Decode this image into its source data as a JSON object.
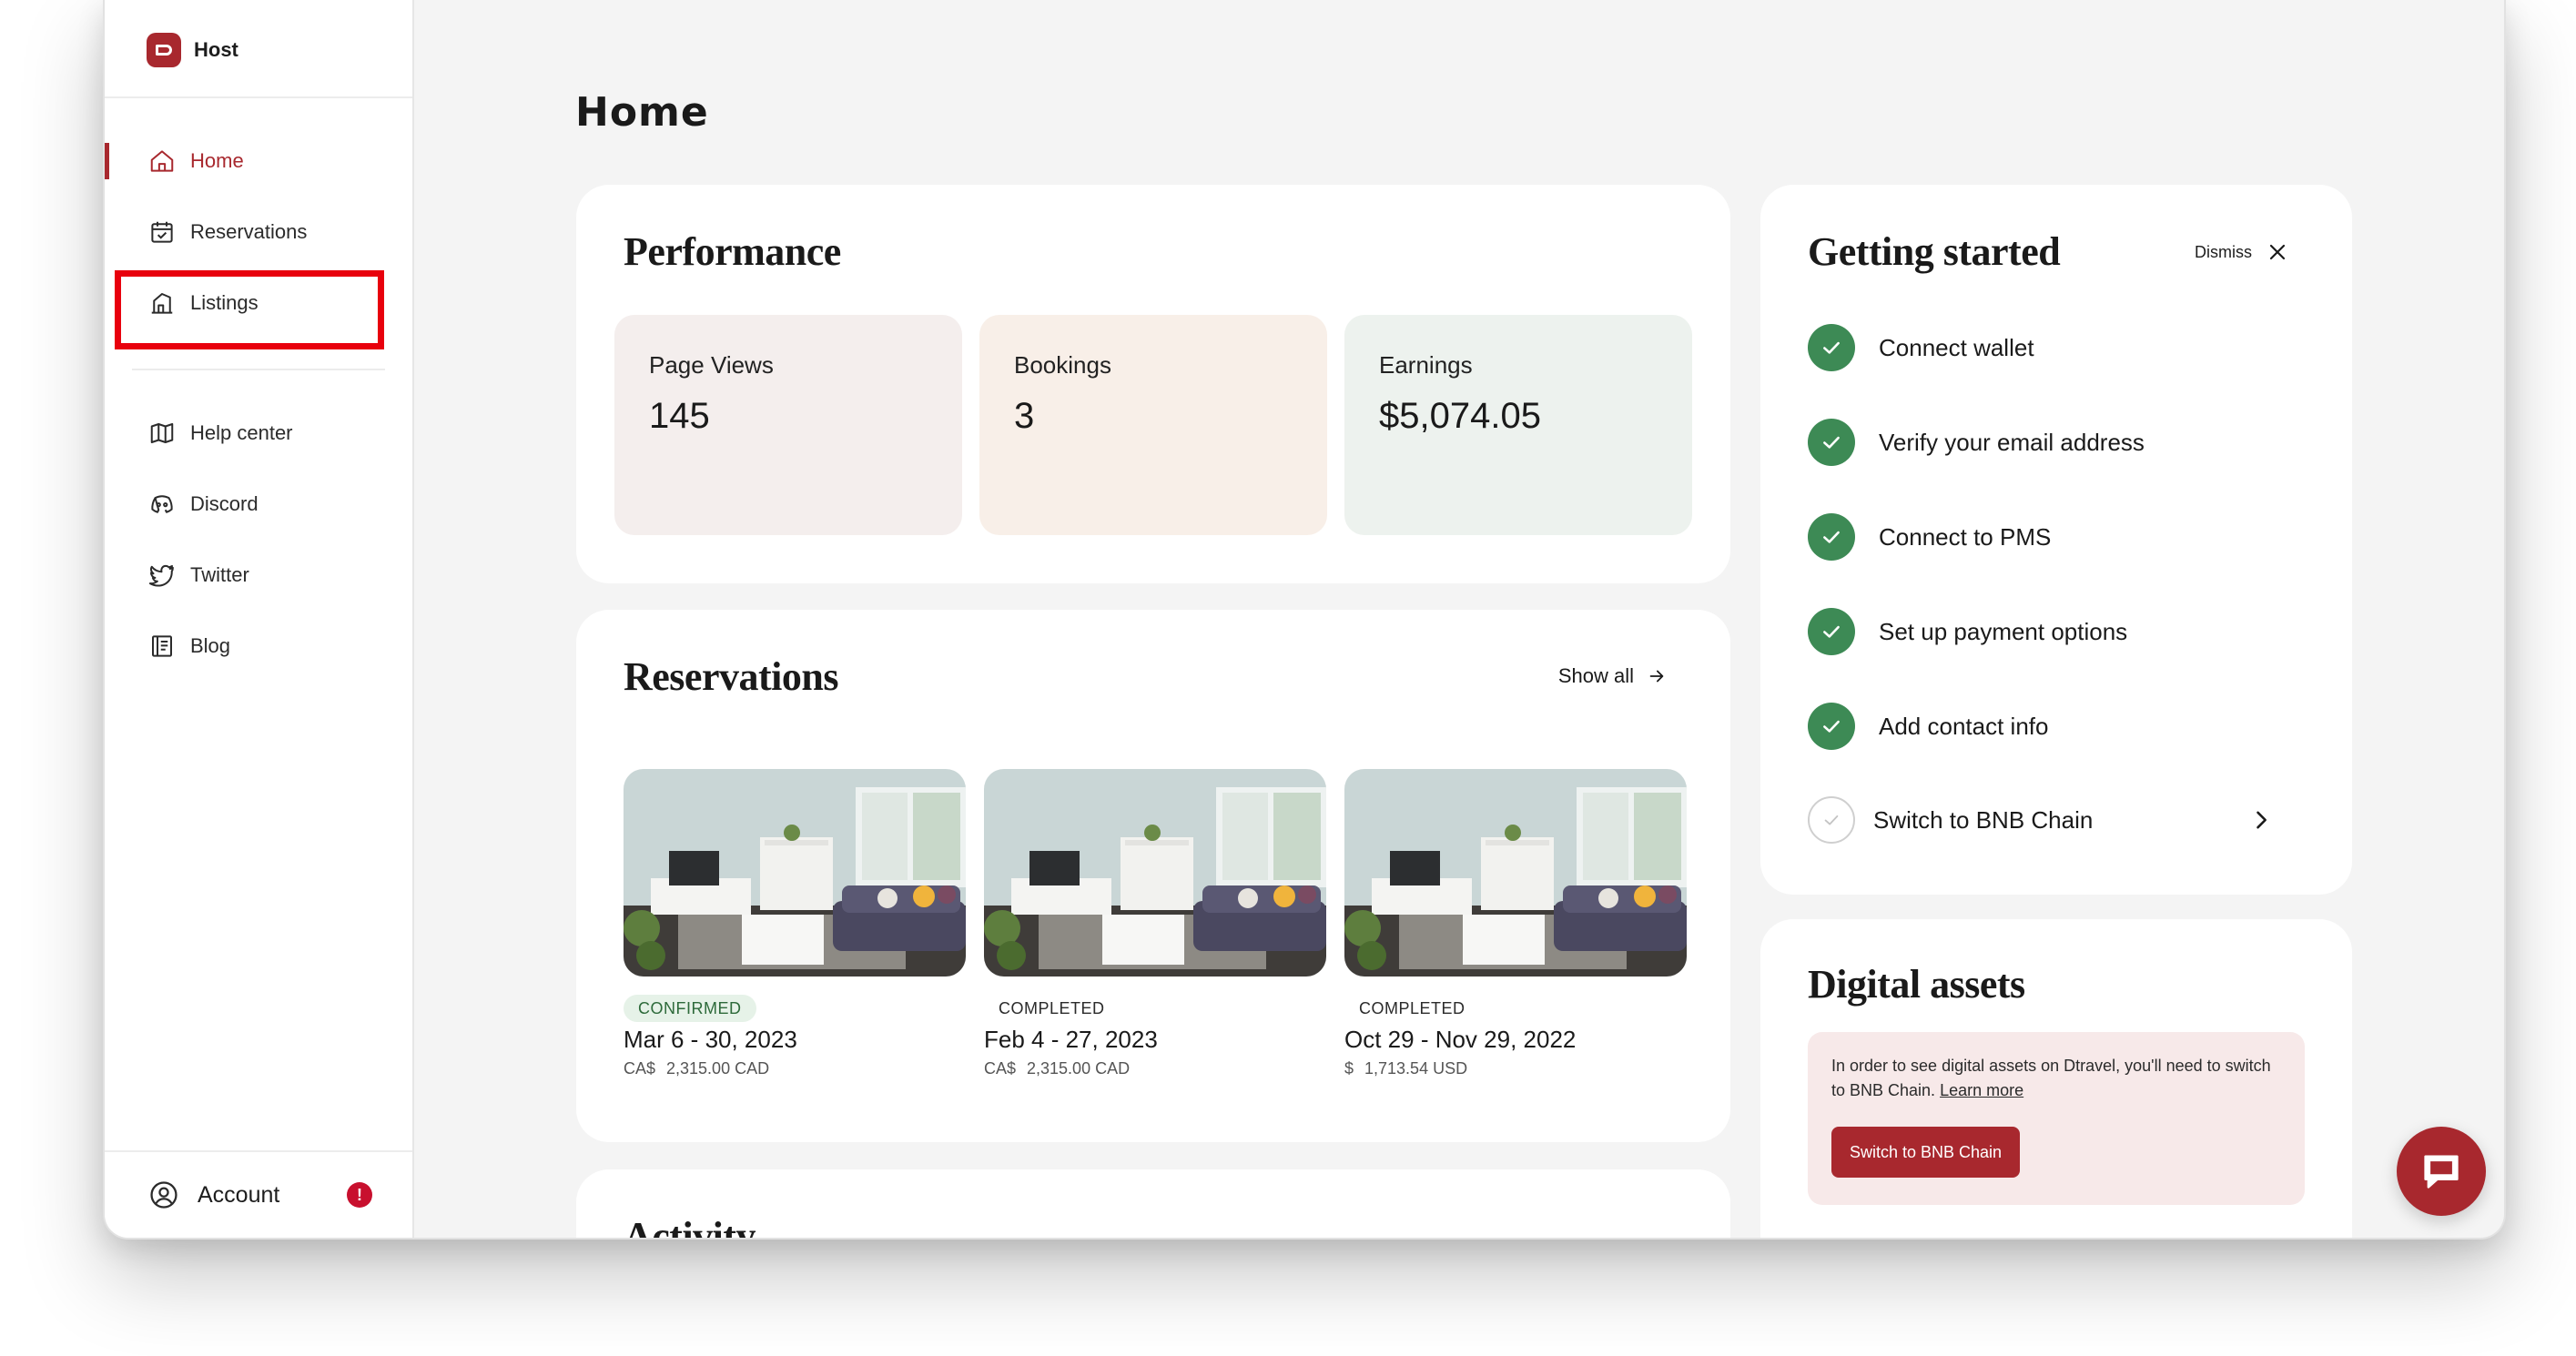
{
  "brand": {
    "name": "Host"
  },
  "sidebar": {
    "items": [
      {
        "label": "Home"
      },
      {
        "label": "Reservations"
      },
      {
        "label": "Listings"
      },
      {
        "label": "Help center"
      },
      {
        "label": "Discord"
      },
      {
        "label": "Twitter"
      },
      {
        "label": "Blog"
      }
    ],
    "account_label": "Account",
    "account_alert": "!"
  },
  "page": {
    "title": "Home"
  },
  "performance": {
    "title": "Performance",
    "stats": [
      {
        "label": "Page Views",
        "value": "145",
        "color": "#f4eeed"
      },
      {
        "label": "Bookings",
        "value": "3",
        "color": "#f8efe8"
      },
      {
        "label": "Earnings",
        "value": "$5,074.05",
        "color": "#edf2ee"
      }
    ]
  },
  "reservations": {
    "title": "Reservations",
    "show_all": "Show all",
    "items": [
      {
        "status": "CONFIRMED",
        "dates": "Mar 6 - 30, 2023",
        "currency": "CA$",
        "amount": "2,315.00 CAD"
      },
      {
        "status": "COMPLETED",
        "dates": "Feb 4 - 27, 2023",
        "currency": "CA$",
        "amount": "2,315.00 CAD"
      },
      {
        "status": "COMPLETED",
        "dates": "Oct 29 - Nov 29, 2022",
        "currency": "$",
        "amount": "1,713.54 USD"
      }
    ]
  },
  "activity": {
    "title": "Activity"
  },
  "getting_started": {
    "title": "Getting started",
    "dismiss": "Dismiss",
    "items": [
      {
        "label": "Connect wallet",
        "done": true
      },
      {
        "label": "Verify your email address",
        "done": true
      },
      {
        "label": "Connect to PMS",
        "done": true
      },
      {
        "label": "Set up payment options",
        "done": true
      },
      {
        "label": "Add contact info",
        "done": true
      },
      {
        "label": "Switch to BNB Chain",
        "done": false
      }
    ]
  },
  "digital_assets": {
    "title": "Digital assets",
    "notice": "In order to see digital assets on Dtravel, you'll need to switch to BNB Chain.",
    "learn_more": "Learn more",
    "button": "Switch to BNB Chain"
  },
  "colors": {
    "brand": "#a8282e",
    "check": "#3d8a55",
    "highlight": "#e8000d"
  },
  "icons": [
    "home-icon",
    "calendar-icon",
    "listings-icon",
    "map-icon",
    "discord-icon",
    "twitter-icon",
    "blog-icon",
    "user-circle-icon",
    "close-icon",
    "arrow-right-icon",
    "chevron-right-icon",
    "check-icon",
    "chat-icon"
  ]
}
